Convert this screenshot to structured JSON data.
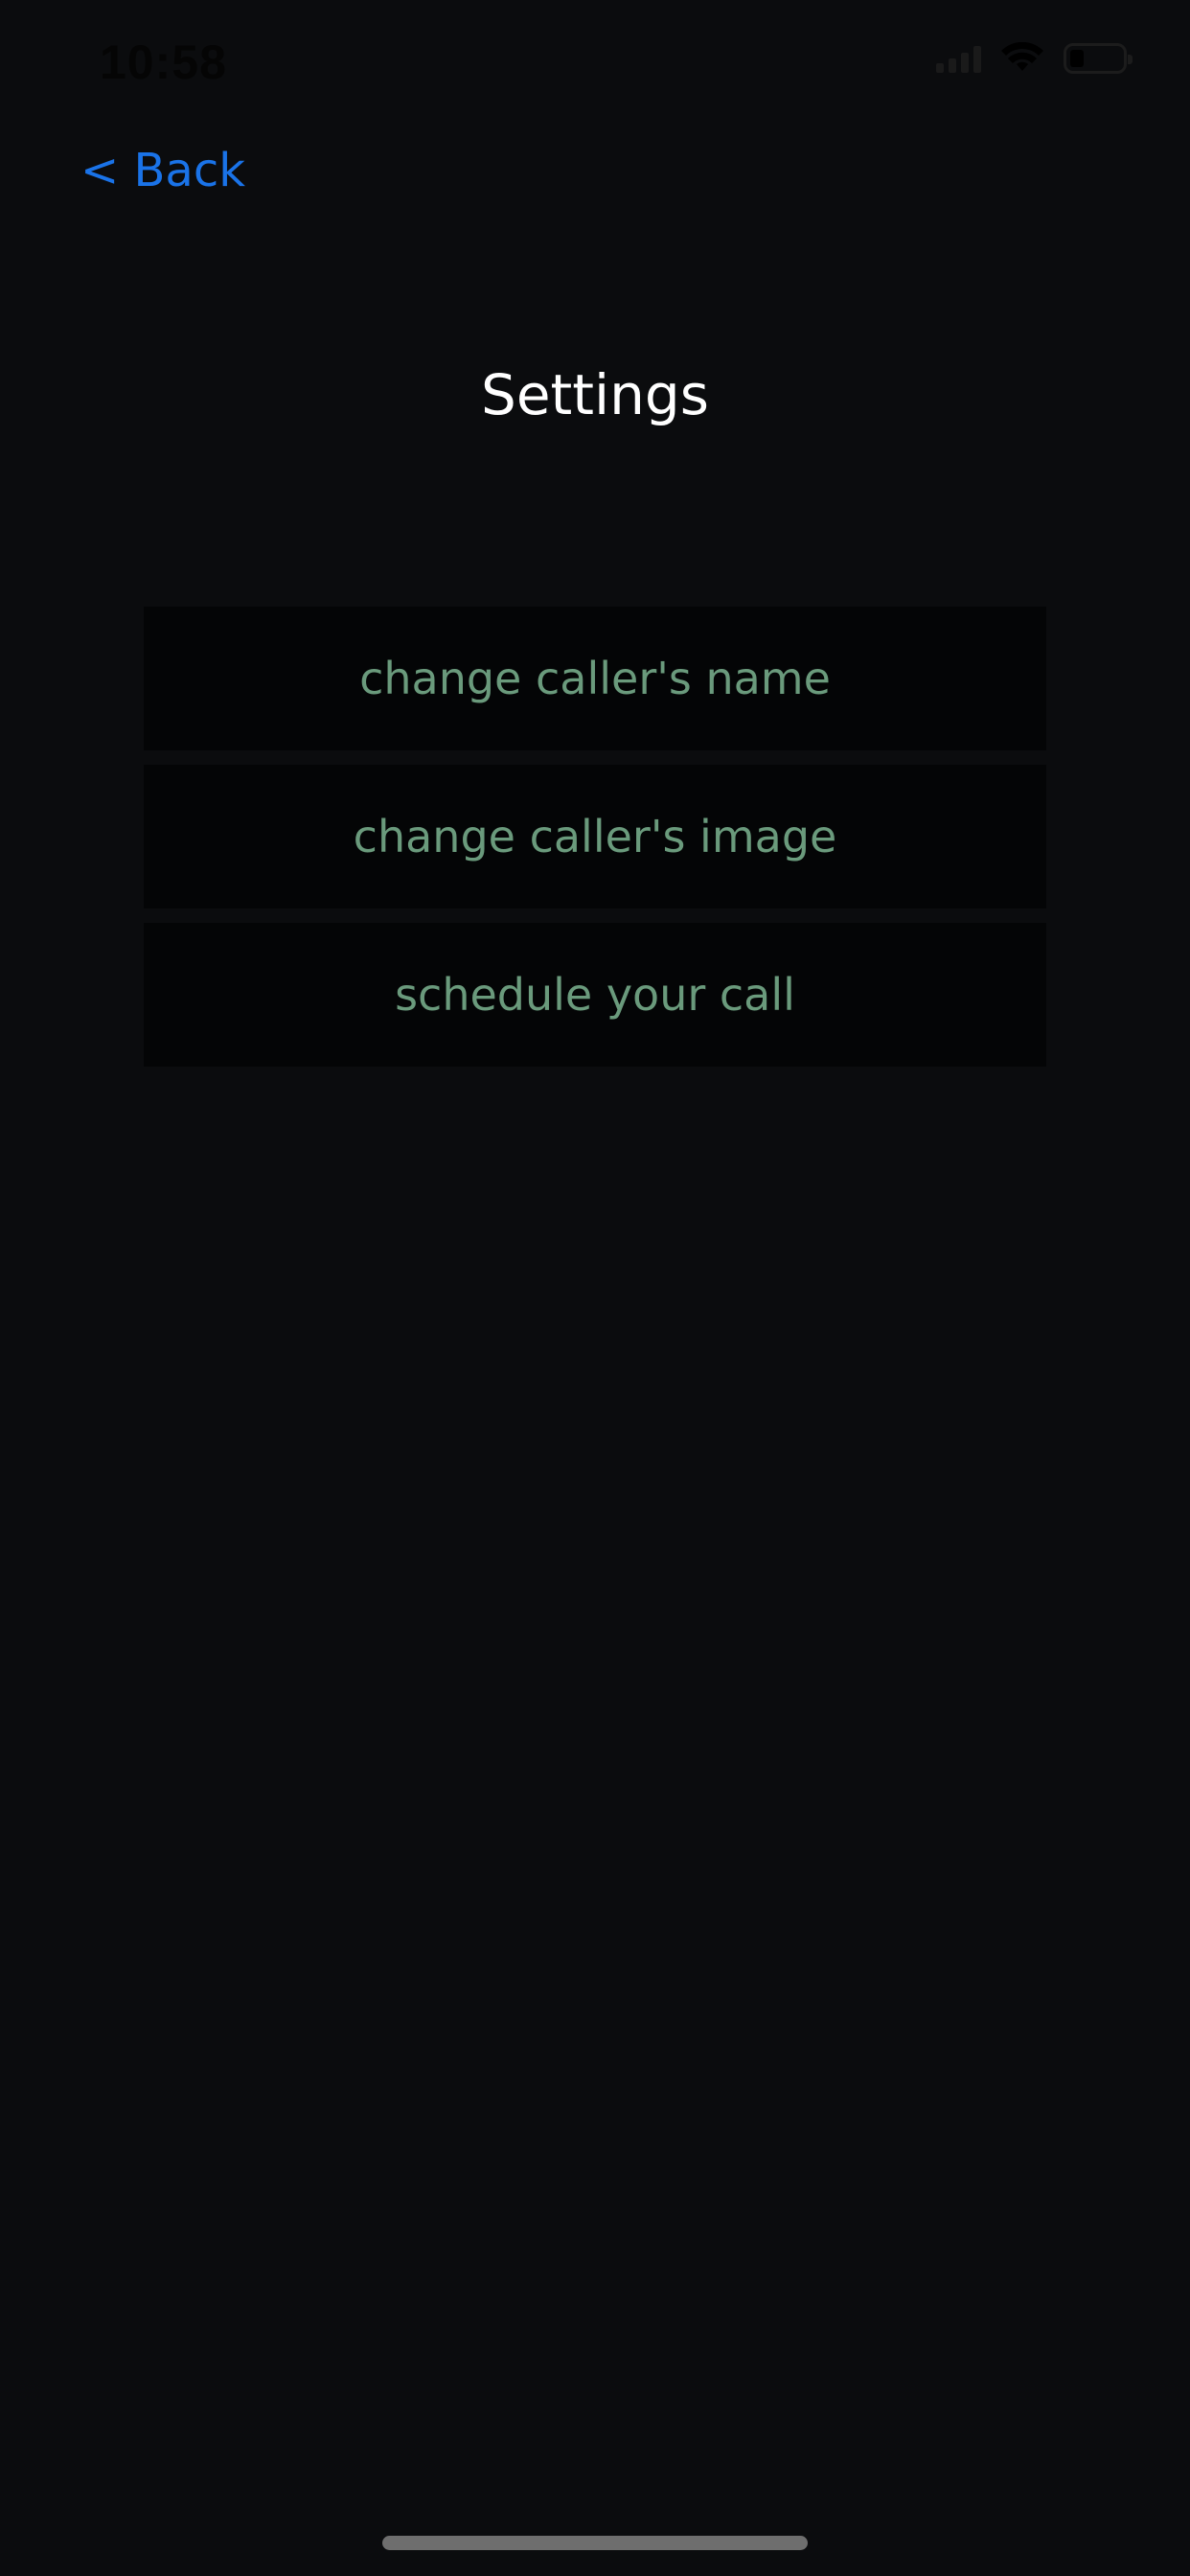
{
  "status_bar": {
    "time": "10:58",
    "icons": [
      "signal-icon",
      "wifi-icon",
      "battery-icon"
    ]
  },
  "nav": {
    "back_label": "< Back"
  },
  "page": {
    "title": "Settings"
  },
  "menu": {
    "items": [
      {
        "label": "change caller's name"
      },
      {
        "label": "change caller's image"
      },
      {
        "label": "schedule your call"
      }
    ]
  },
  "colors": {
    "background": "#0b0c0e",
    "button_background": "#040506",
    "button_text": "#6a9a7c",
    "link": "#1a73e8",
    "title": "#ffffff"
  }
}
